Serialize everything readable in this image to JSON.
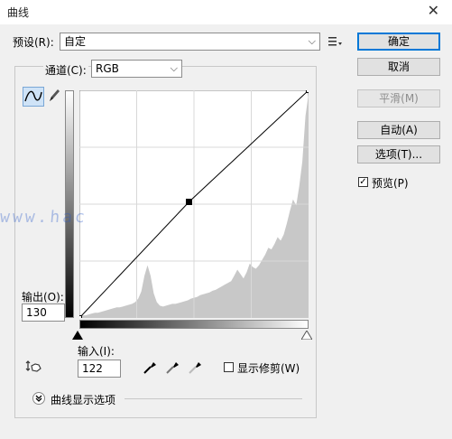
{
  "window": {
    "title": "曲线",
    "close_glyph": "✕"
  },
  "preset": {
    "label": "预设(R):",
    "value": "自定",
    "menu_icon": "preset-options-icon"
  },
  "channel": {
    "label": "通道(C):",
    "value": "RGB"
  },
  "buttons": {
    "ok": "确定",
    "cancel": "取消",
    "smooth": "平滑(M)",
    "auto": "自动(A)",
    "options": "选项(T)..."
  },
  "preview": {
    "label": "预览(P)",
    "checked": true
  },
  "output": {
    "label": "输出(O):",
    "value": "130"
  },
  "input": {
    "label": "输入(I):",
    "value": "122"
  },
  "show_clipping": {
    "label": "显示修剪(W)",
    "checked": false
  },
  "curve_display_options": {
    "label": "曲线显示选项"
  },
  "watermark": {
    "text": "www.hac"
  },
  "curve": {
    "control_point": {
      "input": 122,
      "output": 130
    },
    "endpoints": [
      [
        0,
        0
      ],
      [
        255,
        255
      ]
    ]
  },
  "histogram": [
    2,
    3,
    3,
    4,
    5,
    6,
    6,
    7,
    8,
    9,
    10,
    11,
    12,
    12,
    13,
    14,
    15,
    16,
    18,
    22,
    30,
    48,
    60,
    48,
    28,
    18,
    14,
    13,
    14,
    15,
    16,
    16,
    17,
    18,
    19,
    20,
    22,
    23,
    24,
    26,
    27,
    28,
    29,
    31,
    32,
    34,
    36,
    38,
    40,
    42,
    48,
    55,
    50,
    45,
    52,
    62,
    58,
    56,
    60,
    66,
    72,
    80,
    78,
    84,
    92,
    88,
    95,
    108,
    122,
    135,
    128,
    150,
    178,
    230,
    255
  ],
  "colors": {
    "accent": "#0078d7",
    "hist": "#c8c8c8"
  }
}
